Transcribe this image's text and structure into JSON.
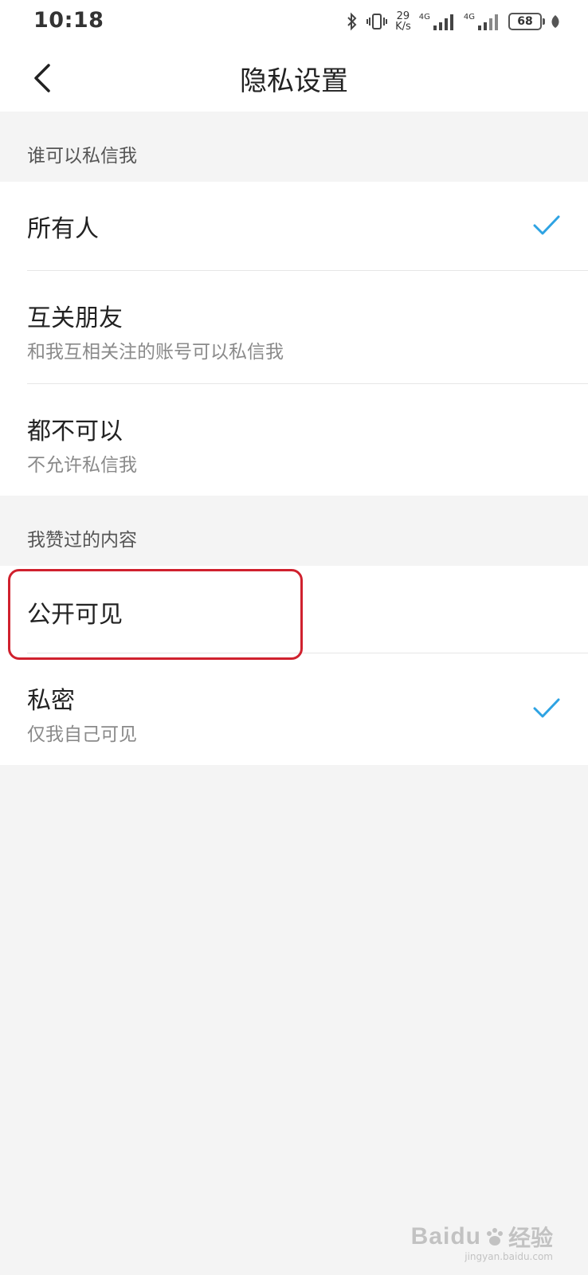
{
  "status_bar": {
    "time": "10:18",
    "net_speed_value": "29",
    "net_speed_unit": "K/s",
    "sim1_label": "4G",
    "sim2_label": "4G",
    "battery_level": "68",
    "icons": [
      "bluetooth-icon",
      "vibrate-icon",
      "signal-icon",
      "signal-icon",
      "battery-icon",
      "leaf-icon"
    ]
  },
  "header": {
    "back_icon": "chevron-left-icon",
    "title": "隐私设置"
  },
  "sections": [
    {
      "header": "谁可以私信我",
      "options": [
        {
          "label": "所有人",
          "description": "",
          "selected": true
        },
        {
          "label": "互关朋友",
          "description": "和我互相关注的账号可以私信我",
          "selected": false
        },
        {
          "label": "都不可以",
          "description": "不允许私信我",
          "selected": false
        }
      ]
    },
    {
      "header": "我赞过的内容",
      "options": [
        {
          "label": "公开可见",
          "description": "",
          "selected": false
        },
        {
          "label": "私密",
          "description": "仅我自己可见",
          "selected": true
        }
      ]
    }
  ],
  "colors": {
    "check": "#2ea3e3",
    "highlight": "#d0212e",
    "background": "#f4f4f4"
  },
  "watermark": {
    "brand": "Baidu",
    "product": "经验",
    "url": "jingyan.baidu.com"
  }
}
